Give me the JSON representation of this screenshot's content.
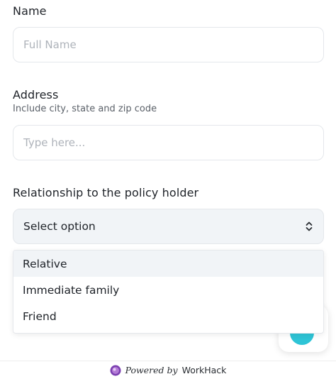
{
  "form": {
    "name": {
      "label": "Name",
      "placeholder": "Full Name",
      "value": ""
    },
    "address": {
      "label": "Address",
      "hint": "Include city, state and zip code",
      "placeholder": "Type here...",
      "value": ""
    },
    "relationship": {
      "label": "Relationship to the policy holder",
      "selected": "Select option",
      "options": [
        "Relative",
        "Immediate family",
        "Friend"
      ],
      "highlighted_index": 0
    }
  },
  "chat_widget": {
    "accent_color": "#2ec4d6",
    "icon": "chat-bubble-icon"
  },
  "footer": {
    "powered_by": "Powered by",
    "brand": "WorkHack",
    "logo_icon": "workhack-logo-icon"
  },
  "colors": {
    "select_background": "#f1f4f7",
    "option_highlight": "#f1f4f7",
    "placeholder": "#aeb3ba"
  }
}
